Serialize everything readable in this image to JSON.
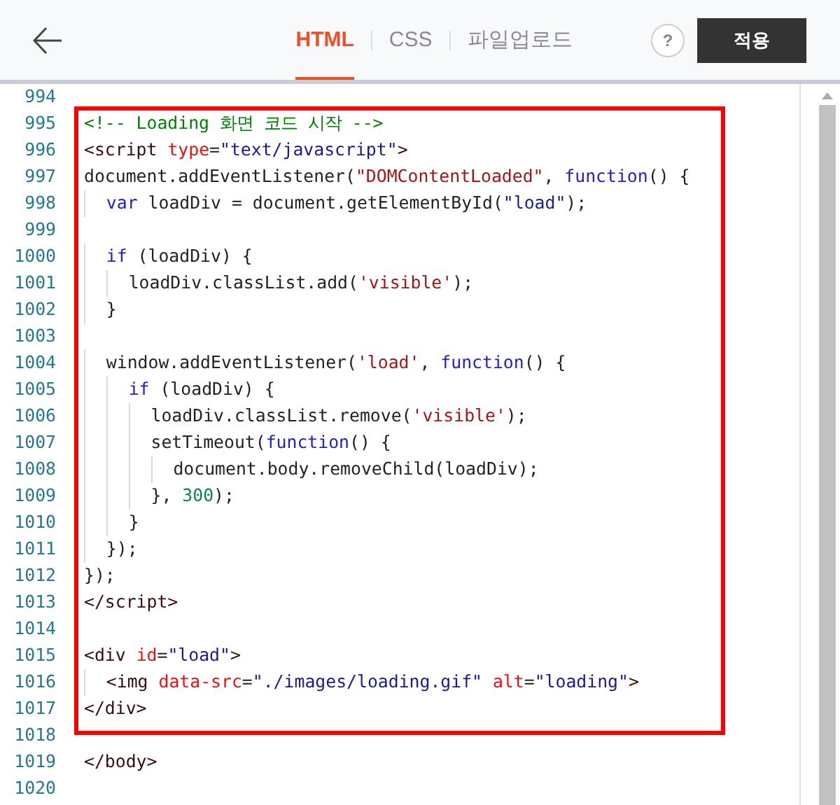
{
  "header": {
    "tabs": [
      {
        "label": "HTML",
        "selected": true
      },
      {
        "label": "CSS",
        "selected": false
      },
      {
        "label": "파일업로드",
        "selected": false
      }
    ],
    "help": "?",
    "apply_button": "적용"
  },
  "editor": {
    "lines": [
      {
        "number": "994"
      },
      {
        "number": "995",
        "tokens": [
          {
            "kind": "comment",
            "text": "<!-- Loading 화면 코드 시작 -->"
          }
        ]
      },
      {
        "number": "996",
        "tokens": [
          {
            "kind": "tag",
            "text": "<script "
          },
          {
            "kind": "attr",
            "text": "type"
          },
          {
            "kind": "plain",
            "text": "="
          },
          {
            "kind": "value",
            "text": "\"text/javascript\""
          },
          {
            "kind": "tag",
            "text": ">"
          }
        ]
      },
      {
        "number": "997",
        "tokens": [
          {
            "kind": "plain",
            "text": "document.addEventListener("
          },
          {
            "kind": "string",
            "text": "\"DOMContentLoaded\""
          },
          {
            "kind": "plain",
            "text": ", "
          },
          {
            "kind": "keyword",
            "text": "function"
          },
          {
            "kind": "plain",
            "text": "() {"
          }
        ]
      },
      {
        "number": "998",
        "tokens": [
          {
            "kind": "keyword",
            "text": "  var"
          },
          {
            "kind": "plain",
            "text": " loadDiv = document.getElementById("
          },
          {
            "kind": "value",
            "text": "\"load\""
          },
          {
            "kind": "plain",
            "text": ");"
          }
        ]
      },
      {
        "number": "999"
      },
      {
        "number": "1000",
        "tokens": [
          {
            "kind": "keyword",
            "text": "  if"
          },
          {
            "kind": "plain",
            "text": " (loadDiv) {"
          }
        ]
      },
      {
        "number": "1001",
        "tokens": [
          {
            "kind": "plain",
            "text": "    loadDiv.classList.add("
          },
          {
            "kind": "string",
            "text": "'visible'"
          },
          {
            "kind": "plain",
            "text": ");"
          }
        ]
      },
      {
        "number": "1002",
        "tokens": [
          {
            "kind": "plain",
            "text": "  }"
          }
        ]
      },
      {
        "number": "1003"
      },
      {
        "number": "1004",
        "tokens": [
          {
            "kind": "plain",
            "text": "  window.addEventListener("
          },
          {
            "kind": "string",
            "text": "'load'"
          },
          {
            "kind": "plain",
            "text": ", "
          },
          {
            "kind": "keyword",
            "text": "function"
          },
          {
            "kind": "plain",
            "text": "() {"
          }
        ]
      },
      {
        "number": "1005",
        "tokens": [
          {
            "kind": "keyword",
            "text": "    if"
          },
          {
            "kind": "plain",
            "text": " (loadDiv) {"
          }
        ]
      },
      {
        "number": "1006",
        "tokens": [
          {
            "kind": "plain",
            "text": "      loadDiv.classList.remove("
          },
          {
            "kind": "string",
            "text": "'visible'"
          },
          {
            "kind": "plain",
            "text": ");"
          }
        ]
      },
      {
        "number": "1007",
        "tokens": [
          {
            "kind": "plain",
            "text": "      setTimeout("
          },
          {
            "kind": "keyword",
            "text": "function"
          },
          {
            "kind": "plain",
            "text": "() {"
          }
        ]
      },
      {
        "number": "1008",
        "tokens": [
          {
            "kind": "plain",
            "text": "        document.body.removeChild(loadDiv);"
          }
        ]
      },
      {
        "number": "1009",
        "tokens": [
          {
            "kind": "plain",
            "text": "      }, "
          },
          {
            "kind": "number",
            "text": "300"
          },
          {
            "kind": "plain",
            "text": ");"
          }
        ]
      },
      {
        "number": "1010",
        "tokens": [
          {
            "kind": "plain",
            "text": "    }"
          }
        ]
      },
      {
        "number": "1011",
        "tokens": [
          {
            "kind": "plain",
            "text": "  });"
          }
        ]
      },
      {
        "number": "1012",
        "tokens": [
          {
            "kind": "plain",
            "text": "});"
          }
        ]
      },
      {
        "number": "1013",
        "tokens": [
          {
            "kind": "tag",
            "text": "</script>"
          }
        ]
      },
      {
        "number": "1014"
      },
      {
        "number": "1015",
        "tokens": [
          {
            "kind": "tag",
            "text": "<div "
          },
          {
            "kind": "attr",
            "text": "id"
          },
          {
            "kind": "plain",
            "text": "="
          },
          {
            "kind": "value",
            "text": "\"load\""
          },
          {
            "kind": "tag",
            "text": ">"
          }
        ]
      },
      {
        "number": "1016",
        "tokens": [
          {
            "kind": "tag",
            "text": "  <img "
          },
          {
            "kind": "attr",
            "text": "data-src"
          },
          {
            "kind": "plain",
            "text": "="
          },
          {
            "kind": "value",
            "text": "\"./images/loading.gif\""
          },
          {
            "kind": "attr",
            "text": " alt"
          },
          {
            "kind": "plain",
            "text": "="
          },
          {
            "kind": "value",
            "text": "\"loading\""
          },
          {
            "kind": "tag",
            "text": ">"
          }
        ]
      },
      {
        "number": "1017",
        "tokens": [
          {
            "kind": "tag",
            "text": "</div>"
          }
        ]
      },
      {
        "number": "1018"
      },
      {
        "number": "1019",
        "tokens": [
          {
            "kind": "tag",
            "text": "</body>"
          }
        ]
      },
      {
        "number": "1020"
      }
    ]
  }
}
